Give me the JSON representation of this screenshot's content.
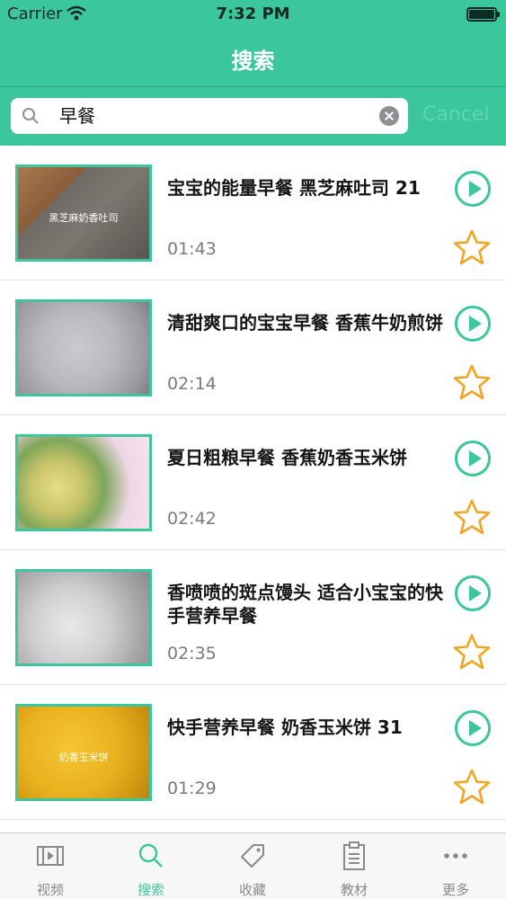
{
  "status_bar": {
    "carrier": "Carrier",
    "time": "7:32 PM"
  },
  "nav": {
    "title": "搜索"
  },
  "search": {
    "query": "早餐",
    "cancel_label": "Cancel"
  },
  "videos": [
    {
      "title": "宝宝的能量早餐 黑芝麻吐司 21",
      "duration": "01:43",
      "thumb_caption": "黑芝麻奶香吐司"
    },
    {
      "title": "清甜爽口的宝宝早餐 香蕉牛奶煎饼",
      "duration": "02:14",
      "thumb_caption": ""
    },
    {
      "title": "夏日粗粮早餐 香蕉奶香玉米饼",
      "duration": "02:42",
      "thumb_caption": ""
    },
    {
      "title": "香喷喷的斑点馒头 适合小宝宝的快手营养早餐",
      "duration": "02:35",
      "thumb_caption": ""
    },
    {
      "title": "快手营养早餐 奶香玉米饼 31",
      "duration": "01:29",
      "thumb_caption": "奶香玉米饼"
    }
  ],
  "tabs": [
    {
      "label": "视频",
      "icon": "film-icon"
    },
    {
      "label": "搜索",
      "icon": "search-icon"
    },
    {
      "label": "收藏",
      "icon": "tag-icon"
    },
    {
      "label": "教材",
      "icon": "clipboard-icon"
    },
    {
      "label": "更多",
      "icon": "more-icon"
    }
  ],
  "colors": {
    "accent": "#3cc69b",
    "star": "#f3a521",
    "duration": "#7a7a7a"
  }
}
